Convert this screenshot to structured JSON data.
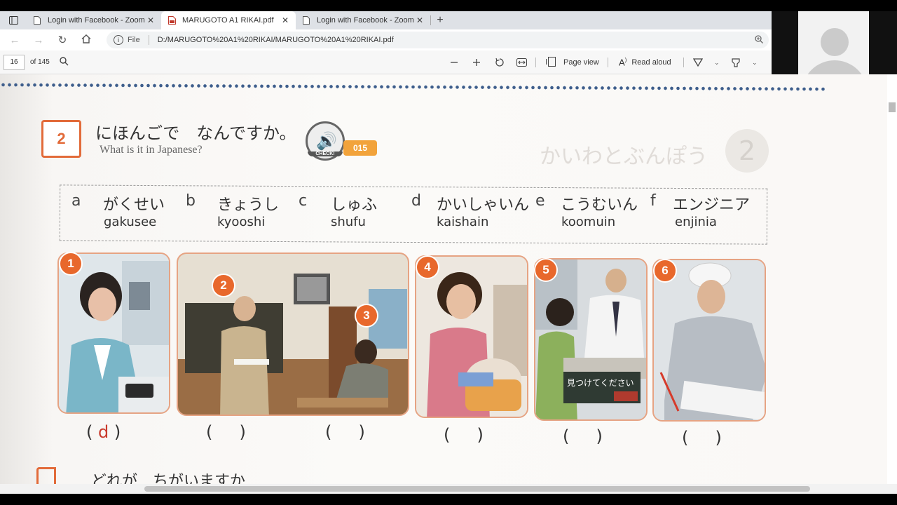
{
  "browser": {
    "tabs": [
      {
        "title": "Login with Facebook - Zoom",
        "active": false,
        "icon": "document-icon"
      },
      {
        "title": "MARUGOTO A1 RIKAI.pdf",
        "active": true,
        "icon": "pdf-icon"
      },
      {
        "title": "Login with Facebook - Zoom",
        "active": false,
        "icon": "document-icon"
      }
    ],
    "url_prefix": "File",
    "url": "D:/MARUGOTO%20A1%20RIKAI/MARUGOTO%20A1%20RIKAI.pdf"
  },
  "pdf_toolbar": {
    "page_number": "16",
    "page_count": "of 145",
    "page_view_label": "Page view",
    "read_aloud_label": "Read aloud"
  },
  "document": {
    "section_number": "2",
    "section_title_jp": "にほんごで　なんですか。",
    "section_title_en": "What is it in Japanese?",
    "check_label": "CHECK!",
    "track_number": "015",
    "words": [
      {
        "letter": "a",
        "kana": "がくせい",
        "romaji": "gakusee"
      },
      {
        "letter": "b",
        "kana": "きょうし",
        "romaji": "kyooshi"
      },
      {
        "letter": "c",
        "kana": "しゅふ",
        "romaji": "shufu"
      },
      {
        "letter": "d",
        "kana": "かいしゃいん",
        "romaji": "kaishain"
      },
      {
        "letter": "e",
        "kana": "こうむいん",
        "romaji": "koomuin"
      },
      {
        "letter": "f",
        "kana": "エンジニア",
        "romaji": "enjinia"
      }
    ],
    "photo_numbers": [
      "1",
      "2",
      "3",
      "4",
      "5",
      "6"
    ],
    "sign_text": "見つけてください",
    "answers": [
      "d",
      "",
      "",
      "",
      "",
      ""
    ],
    "next_section_title": "どれが　ちがいますか",
    "ghost_title": "かいわとぶんぽう"
  }
}
